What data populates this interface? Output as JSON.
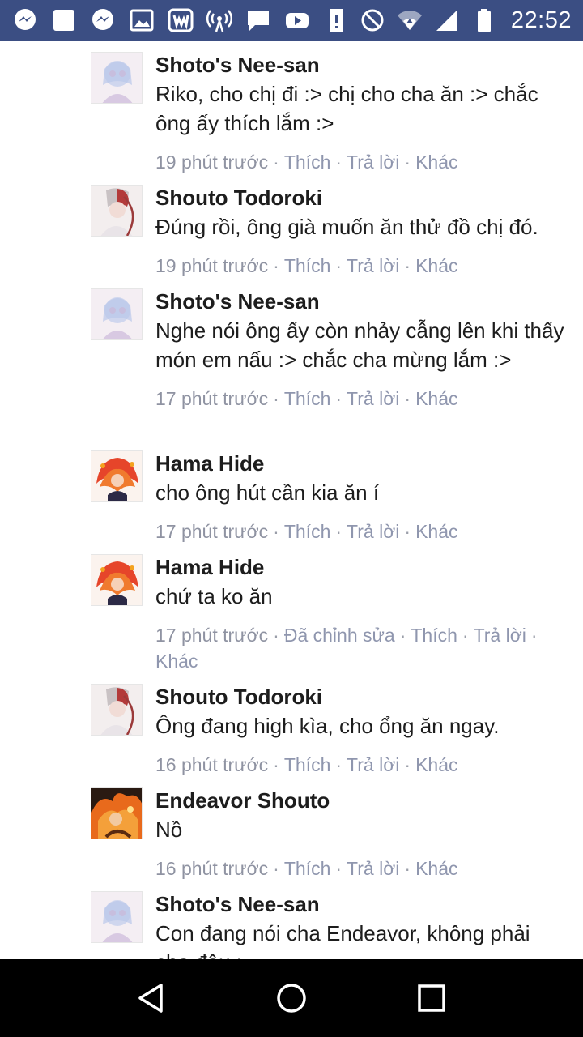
{
  "status_bar": {
    "time": "22:52",
    "left_icons": [
      "messenger-icon",
      "square-app-icon",
      "messenger-icon",
      "gallery-icon",
      "wattpad-icon",
      "hotspot-icon",
      "chat-bubble-icon",
      "youtube-icon",
      "sd-alert-icon"
    ],
    "right_icons": [
      "do-not-disturb-icon",
      "wifi-icon",
      "cell-signal-icon",
      "battery-icon"
    ]
  },
  "comments": [
    {
      "author": "Shoto's Nee-san",
      "avatar": "nee-san-avatar",
      "text": "Riko, cho chị đi :> chị cho cha ăn :> chắc ông ấy thích lắm :>",
      "time": "19 phút trước",
      "actions": [
        "Thích",
        "Trả lời",
        "Khác"
      ]
    },
    {
      "author": "Shouto Todoroki",
      "avatar": "todoroki-avatar",
      "text": "Đúng rồi, ông già muốn ăn thử đồ chị đó.",
      "time": "19 phút trước",
      "actions": [
        "Thích",
        "Trả lời",
        "Khác"
      ]
    },
    {
      "author": "Shoto's Nee-san",
      "avatar": "nee-san-avatar",
      "text": "Nghe nói ông ấy còn nhảy cẫng lên khi thấy món em nấu :> chắc cha mừng lắm :>",
      "time": "17 phút trước",
      "actions": [
        "Thích",
        "Trả lời",
        "Khác"
      ]
    },
    {
      "author": "Hama Hide",
      "avatar": "hama-hide-avatar",
      "text": "cho ông hút cần kia ăn í",
      "time": "17 phút trước",
      "actions": [
        "Thích",
        "Trả lời",
        "Khác"
      ]
    },
    {
      "author": "Hama Hide",
      "avatar": "hama-hide-avatar",
      "text": "chứ ta ko ăn",
      "time": "17 phút trước",
      "edited": "Đã chỉnh sửa",
      "actions": [
        "Thích",
        "Trả lời",
        "Khác"
      ]
    },
    {
      "author": "Shouto Todoroki",
      "avatar": "todoroki-avatar",
      "text": "Ông đang high kìa, cho ổng ăn ngay.",
      "time": "16 phút trước",
      "actions": [
        "Thích",
        "Trả lời",
        "Khác"
      ]
    },
    {
      "author": "Endeavor Shouto",
      "avatar": "endeavor-avatar",
      "text": "Nồ",
      "time": "16 phút trước",
      "actions": [
        "Thích",
        "Trả lời",
        "Khác"
      ]
    },
    {
      "author": "Shoto's Nee-san",
      "avatar": "nee-san-avatar",
      "text": "Con đang nói cha Endeavor, không phải cha đâu :",
      "time": "",
      "actions": []
    }
  ],
  "nav_bar": {
    "buttons": [
      "back-icon",
      "home-icon",
      "recents-icon"
    ]
  },
  "colors": {
    "status_bar_bg": "#3b4e83",
    "text": "#1d1d1d",
    "meta_text": "#8f93a2",
    "nav_bar_bg": "#000000"
  }
}
